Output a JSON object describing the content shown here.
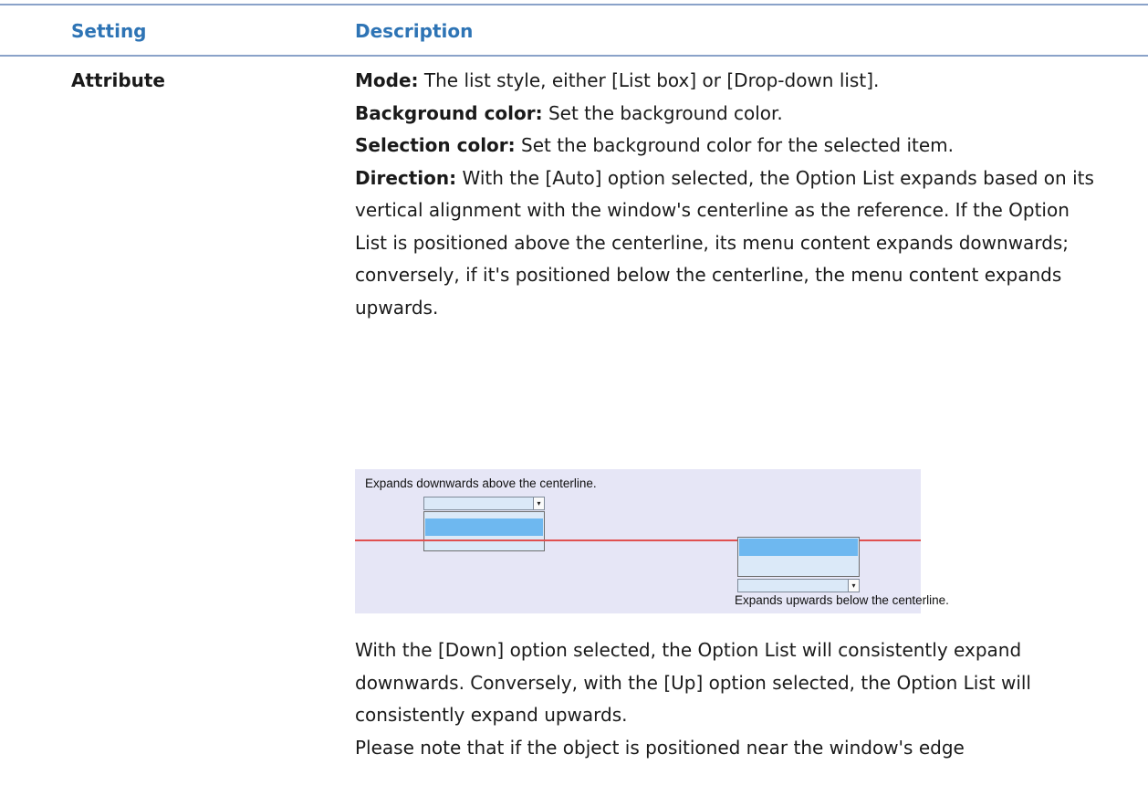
{
  "header": {
    "setting": "Setting",
    "description": "Description"
  },
  "row": {
    "setting": "Attribute",
    "mode_label": "Mode:",
    "mode_text": " The list style, either [List box] or [Drop-down list].",
    "bg_label": "Background color:",
    "bg_text": " Set the background color.",
    "sel_label": "Selection color:",
    "sel_text": " Set the background color for the selected item.",
    "dir_label": "Direction:",
    "dir_text": " With the [Auto] option selected, the Option List expands based on its vertical alignment with the window's centerline as the reference. If the Option List is positioned above the centerline, its menu content expands downwards; conversely, if it's positioned below the centerline, the menu content expands upwards.",
    "illustration": {
      "top_caption": "Expands downwards above the centerline.",
      "bottom_caption": "Expands upwards below the centerline.",
      "dropdown_arrow": "▾",
      "background_color": "#e6e6f6",
      "centerline_color": "#e05050",
      "selection_color": "#6eb8f0"
    },
    "para2": "With the [Down] option selected, the Option List will consistently expand downwards. Conversely, with the [Up] option selected, the Option List will consistently expand upwards.",
    "para3": "Please note that if the object is positioned near the window's edge"
  }
}
